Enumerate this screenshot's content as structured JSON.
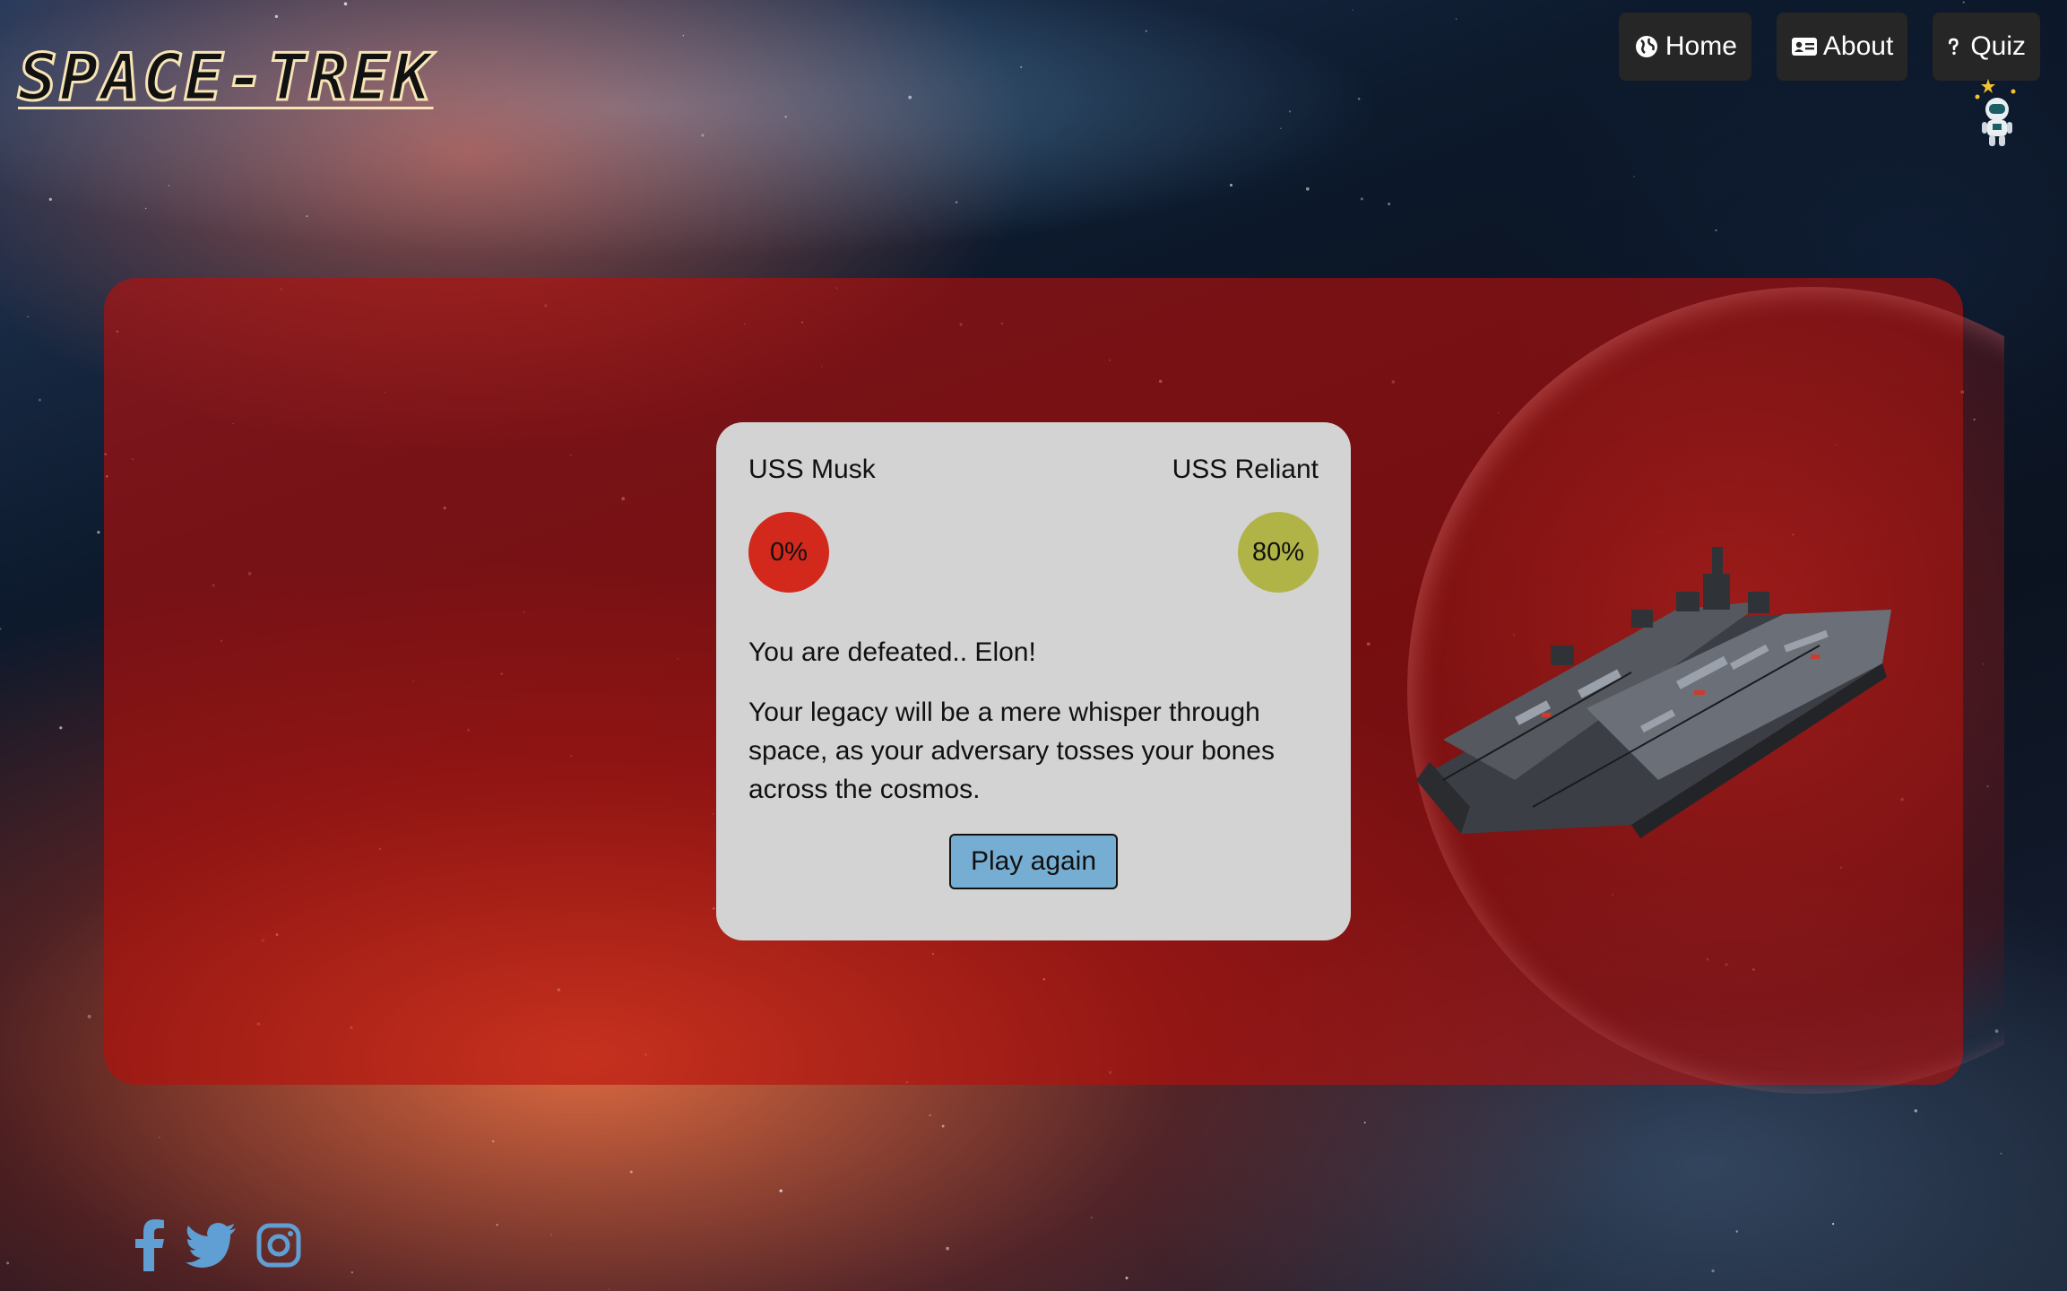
{
  "header": {
    "logo_text": "SPACE-TREK",
    "nav": [
      {
        "label": "Home",
        "icon": "globe-icon"
      },
      {
        "label": "About",
        "icon": "id-card-icon"
      },
      {
        "label": "Quiz",
        "icon": "question-icon"
      }
    ]
  },
  "battle": {
    "player_ship": "USS Musk",
    "enemy_ship": "USS Reliant",
    "player_score": "0%",
    "enemy_score": "80%",
    "result_title": "You are defeated.. Elon!",
    "result_message": "Your legacy will be a mere whisper through space, as your adversary tosses your bones across the cosmos.",
    "play_again_label": "Play again"
  },
  "footer": {
    "social": [
      "facebook-icon",
      "twitter-icon",
      "instagram-icon"
    ]
  },
  "colors": {
    "panel": "#b90e0a",
    "card": "#d3d3d3",
    "player_score": "#d2291c",
    "enemy_score": "#b0b447",
    "play_button": "#76aed3",
    "nav_button": "#262626",
    "logo_outline": "#f7e4b6"
  }
}
